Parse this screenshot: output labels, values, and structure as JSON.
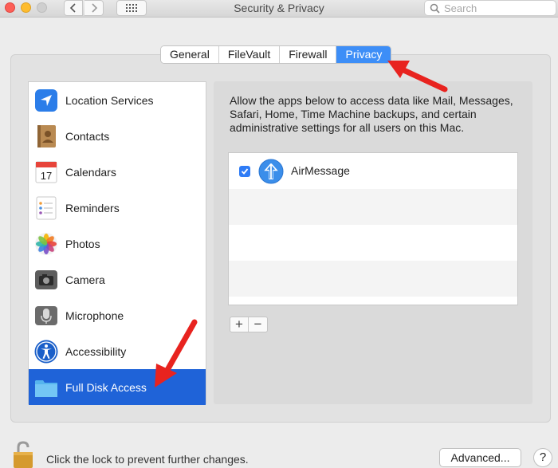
{
  "window": {
    "title": "Security & Privacy",
    "search_placeholder": "Search"
  },
  "tabs": [
    {
      "label": "General",
      "active": false
    },
    {
      "label": "FileVault",
      "active": false
    },
    {
      "label": "Firewall",
      "active": false
    },
    {
      "label": "Privacy",
      "active": true
    }
  ],
  "sidebar": {
    "items": [
      {
        "label": "Location Services",
        "icon": "location-icon"
      },
      {
        "label": "Contacts",
        "icon": "contacts-icon"
      },
      {
        "label": "Calendars",
        "icon": "calendar-icon",
        "icon_text": "17"
      },
      {
        "label": "Reminders",
        "icon": "reminders-icon"
      },
      {
        "label": "Photos",
        "icon": "photos-icon"
      },
      {
        "label": "Camera",
        "icon": "camera-icon"
      },
      {
        "label": "Microphone",
        "icon": "microphone-icon"
      },
      {
        "label": "Accessibility",
        "icon": "accessibility-icon"
      },
      {
        "label": "Full Disk Access",
        "icon": "folder-icon",
        "selected": true
      }
    ]
  },
  "main": {
    "description": "Allow the apps below to access data like Mail, Messages, Safari, Home, Time Machine backups, and certain administrative settings for all users on this Mac.",
    "apps": [
      {
        "name": "AirMessage",
        "checked": true,
        "icon": "airmessage-icon"
      }
    ],
    "add_label": "+",
    "remove_label": "−"
  },
  "footer": {
    "lock_text": "Click the lock to prevent further changes.",
    "advanced_label": "Advanced...",
    "help_label": "?"
  },
  "colors": {
    "accent": "#3d8ef7",
    "selection": "#1f63d8",
    "annotation": "#e8231f"
  }
}
